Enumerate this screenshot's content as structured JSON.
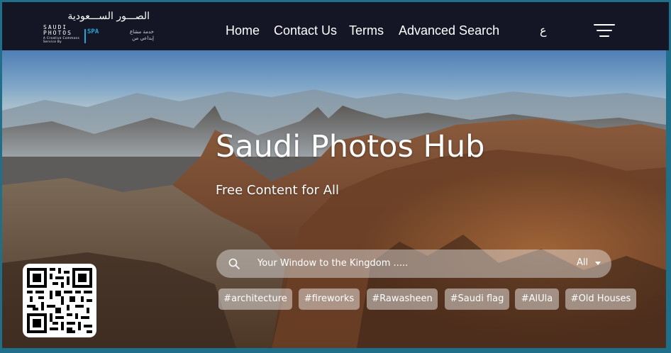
{
  "header": {
    "logo_arabic": "الصـــور الســـعودية",
    "logo_lines": [
      "SAUDI",
      "PHOTOS"
    ],
    "logo_tagline": "A Creative Commons Service By",
    "partner_mark": "SPA",
    "partner_arabic": [
      "خدمة مشاع",
      "إبداعي من"
    ],
    "nav": [
      "Home",
      "Contact Us",
      "Terms",
      "Advanced Search"
    ],
    "language_toggle": "ع",
    "menu_icon": "hamburger-icon"
  },
  "hero": {
    "title": "Saudi Photos Hub",
    "subtitle": "Free Content for All"
  },
  "search": {
    "placeholder": "Your Window to the Kingdom .....",
    "scope": "All",
    "icon": "search-icon"
  },
  "tags": [
    "#architecture",
    "#fireworks",
    "#Rawasheen",
    "#Saudi flag",
    "#AlUla",
    "#Old Houses"
  ],
  "qr_icon": "qr-code-icon",
  "colors": {
    "topbar": "#141626",
    "frame": "#1f6f8b",
    "accent": "#1fa6dc"
  }
}
